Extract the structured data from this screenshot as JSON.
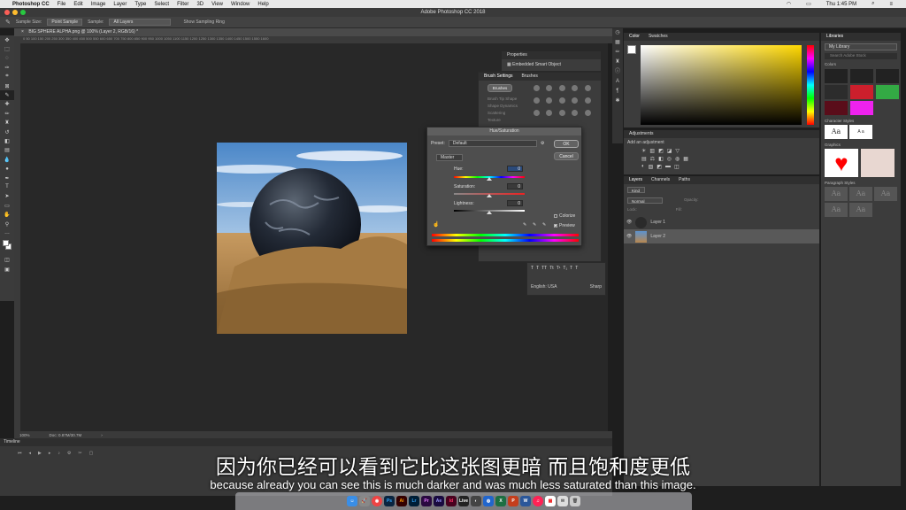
{
  "menubar": {
    "app": "Photoshop CC",
    "items": [
      "File",
      "Edit",
      "Image",
      "Layer",
      "Type",
      "Select",
      "Filter",
      "3D",
      "View",
      "Window",
      "Help"
    ],
    "clock": "Thu 1:45 PM"
  },
  "titlebar": {
    "title": "Adobe Photoshop CC 2018"
  },
  "options": {
    "sample_size_label": "Sample Size:",
    "sample_size": "Point Sample",
    "sample_label": "Sample:",
    "sample": "All Layers",
    "show_ring": "Show Sampling Ring"
  },
  "document": {
    "tab": "BIG SPHERE ALPHA.png @ 100% (Layer 2, RGB/16) *",
    "zoom": "100%",
    "doc_size": "Doc: 0.87M/30.7M",
    "ruler": "0   50   100   150   200   250   300   350   400   450   500   550   600   650   700   750   800   850   900   950   1000   1050   1100   1150   1200   1250   1300   1350   1400   1450   1500   1550   1600"
  },
  "timeline": {
    "title": "Timeline"
  },
  "properties": {
    "title": "Properties",
    "item": "Embedded Smart Object"
  },
  "brush": {
    "tabs": [
      "Brush Settings",
      "Brushes"
    ],
    "brushes_btn": "Brushes",
    "options": [
      "Brush Tip Shape",
      "Shape Dynamics",
      "Scattering",
      "Texture"
    ]
  },
  "hue_sat": {
    "title": "Hue/Saturation",
    "preset_label": "Preset:",
    "preset": "Default",
    "channel": "Master",
    "hue_label": "Hue:",
    "hue": "0",
    "sat_label": "Saturation:",
    "sat": "0",
    "light_label": "Lightness:",
    "light": "0",
    "ok": "OK",
    "cancel": "Cancel",
    "colorize": "Colorize",
    "preview": "Preview",
    "preview_checked": true,
    "colorize_checked": false
  },
  "character": {
    "language": "English: USA",
    "aa": "Sharp"
  },
  "color_panel": {
    "tabs": [
      "Color",
      "Swatches"
    ]
  },
  "adjustments": {
    "title": "Adjustments",
    "subtitle": "Add an adjustment"
  },
  "layers": {
    "tabs": [
      "Layers",
      "Channels",
      "Paths"
    ],
    "kind": "Kind",
    "mode": "Normal",
    "opacity_label": "Opacity:",
    "lock_label": "Lock:",
    "fill_label": "Fill:",
    "items": [
      {
        "name": "Layer 1"
      },
      {
        "name": "Layer 2"
      }
    ]
  },
  "libraries": {
    "title": "Libraries",
    "library": "My Library",
    "search": "Search Adobe Stock",
    "colors_title": "Colors",
    "swatches": [
      "#222222",
      "#222222",
      "#222222",
      "#2c2c2c",
      "#cc1f2c",
      "#33aa44",
      "#5a0d1a",
      "#ee22ee"
    ],
    "char_title": "Character Styles",
    "sample_aa": "Aa",
    "sample_a": "A a",
    "graphics_title": "Graphics",
    "para_title": "Paragraph Styles"
  },
  "subtitles": {
    "cn": "因为你已经可以看到它比这张图更暗 而且饱和度更低",
    "en": "because already you can see this is much darker and was much less saturated than this image."
  },
  "dock": {
    "apps": [
      "Finder",
      "Launchpad",
      "Chrome",
      "Ps",
      "Ai",
      "Lr",
      "Pr",
      "Ae",
      "Id",
      "Live",
      "Excel",
      "PowerPoint",
      "Word",
      "Music",
      "Calendar",
      "Mail",
      "Trash"
    ]
  }
}
